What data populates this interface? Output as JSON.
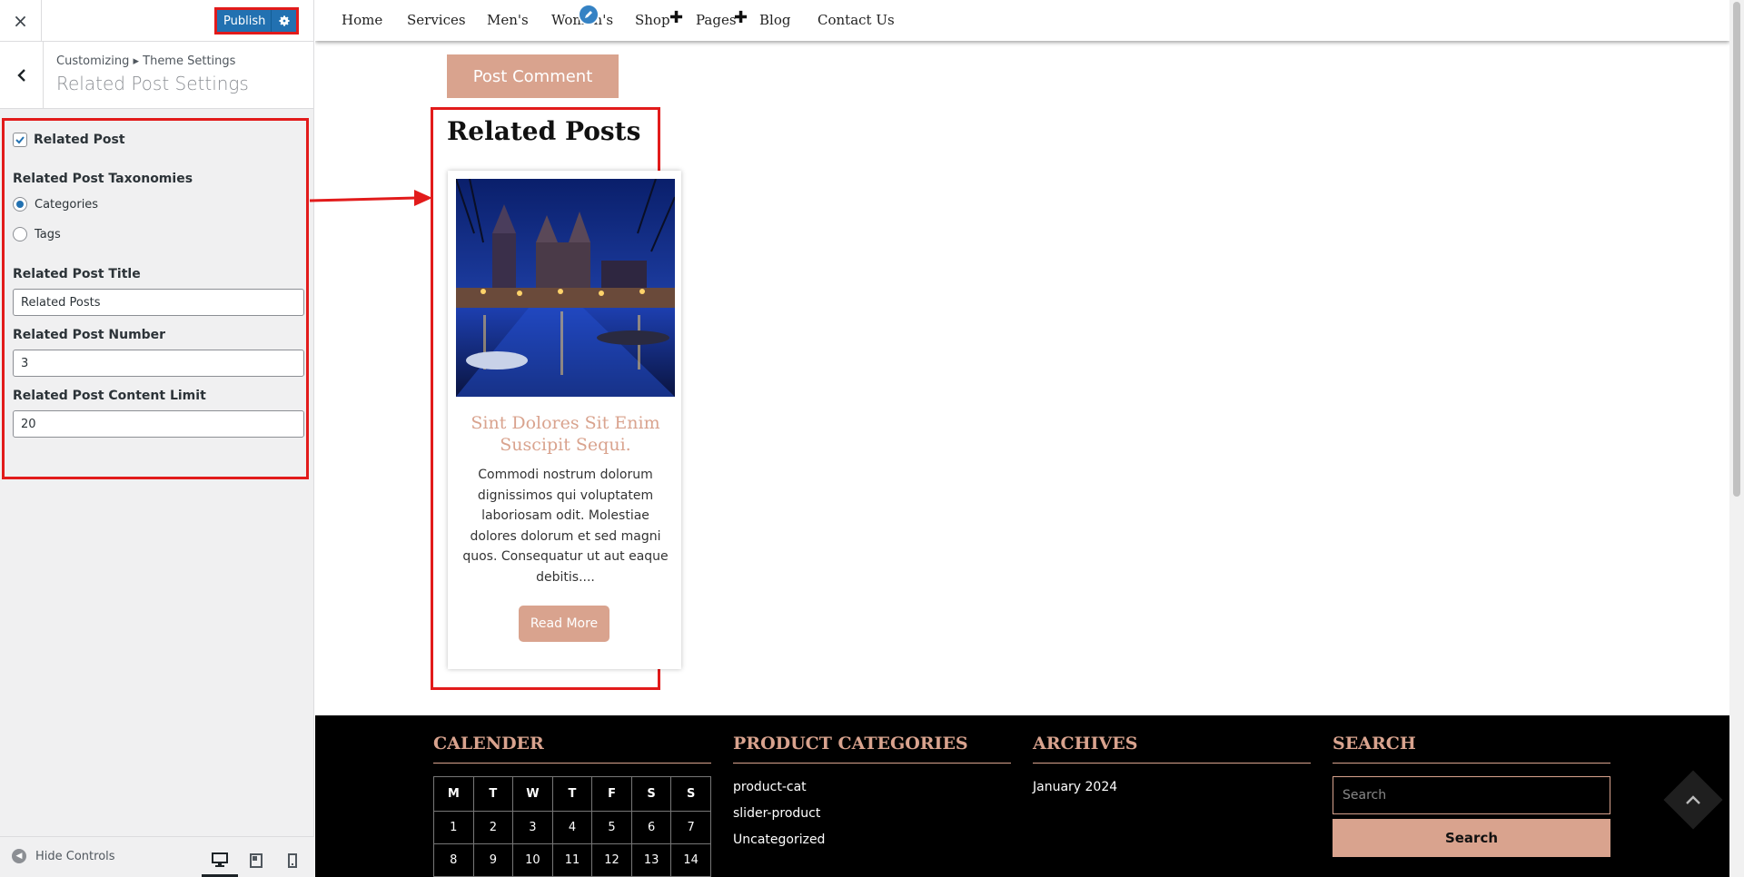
{
  "customizer": {
    "close_label": "×",
    "publish_label": "Publish",
    "breadcrumb": "Customizing ▸ Theme Settings",
    "section_title": "Related Post Settings",
    "related_post_label": "Related Post",
    "related_post_checked": true,
    "taxonomies_label": "Related Post Taxonomies",
    "taxonomy_options": [
      "Categories",
      "Tags"
    ],
    "taxonomy_selected": "Categories",
    "title_label": "Related Post Title",
    "title_value": "Related Posts",
    "number_label": "Related Post Number",
    "number_value": "3",
    "content_limit_label": "Related Post Content Limit",
    "content_limit_value": "20",
    "hide_controls_label": "Hide Controls"
  },
  "nav": {
    "items": [
      "Home",
      "Services",
      "Men's",
      "Women's",
      "Shop",
      "Pages",
      "Blog",
      "Contact Us"
    ]
  },
  "post_comment_label": "Post Comment",
  "related": {
    "heading": "Related Posts",
    "post": {
      "title": "Sint Dolores Sit Enim Suscipit Sequi.",
      "excerpt": "Commodi nostrum dolorum dignissimos qui voluptatem laboriosam odit. Molestiae dolores dolorum et sed magni quos. Consequatur ut aut eaque debitis....",
      "read_more": "Read More"
    }
  },
  "footer": {
    "calendar": {
      "heading": "CALENDER",
      "days": [
        "M",
        "T",
        "W",
        "T",
        "F",
        "S",
        "S"
      ],
      "rows": [
        [
          "1",
          "2",
          "3",
          "4",
          "5",
          "6",
          "7"
        ],
        [
          "8",
          "9",
          "10",
          "11",
          "12",
          "13",
          "14"
        ]
      ]
    },
    "categories": {
      "heading": "PRODUCT CATEGORIES",
      "items": [
        "product-cat",
        "slider-product",
        "Uncategorized"
      ]
    },
    "archives": {
      "heading": "ARCHIVES",
      "items": [
        "January 2024"
      ]
    },
    "search": {
      "heading": "SEARCH",
      "placeholder": "Search",
      "button_label": "Search"
    }
  },
  "colors": {
    "accent": "#d9a38e",
    "highlight": "#e21b1b",
    "wp_blue": "#2271b1"
  }
}
